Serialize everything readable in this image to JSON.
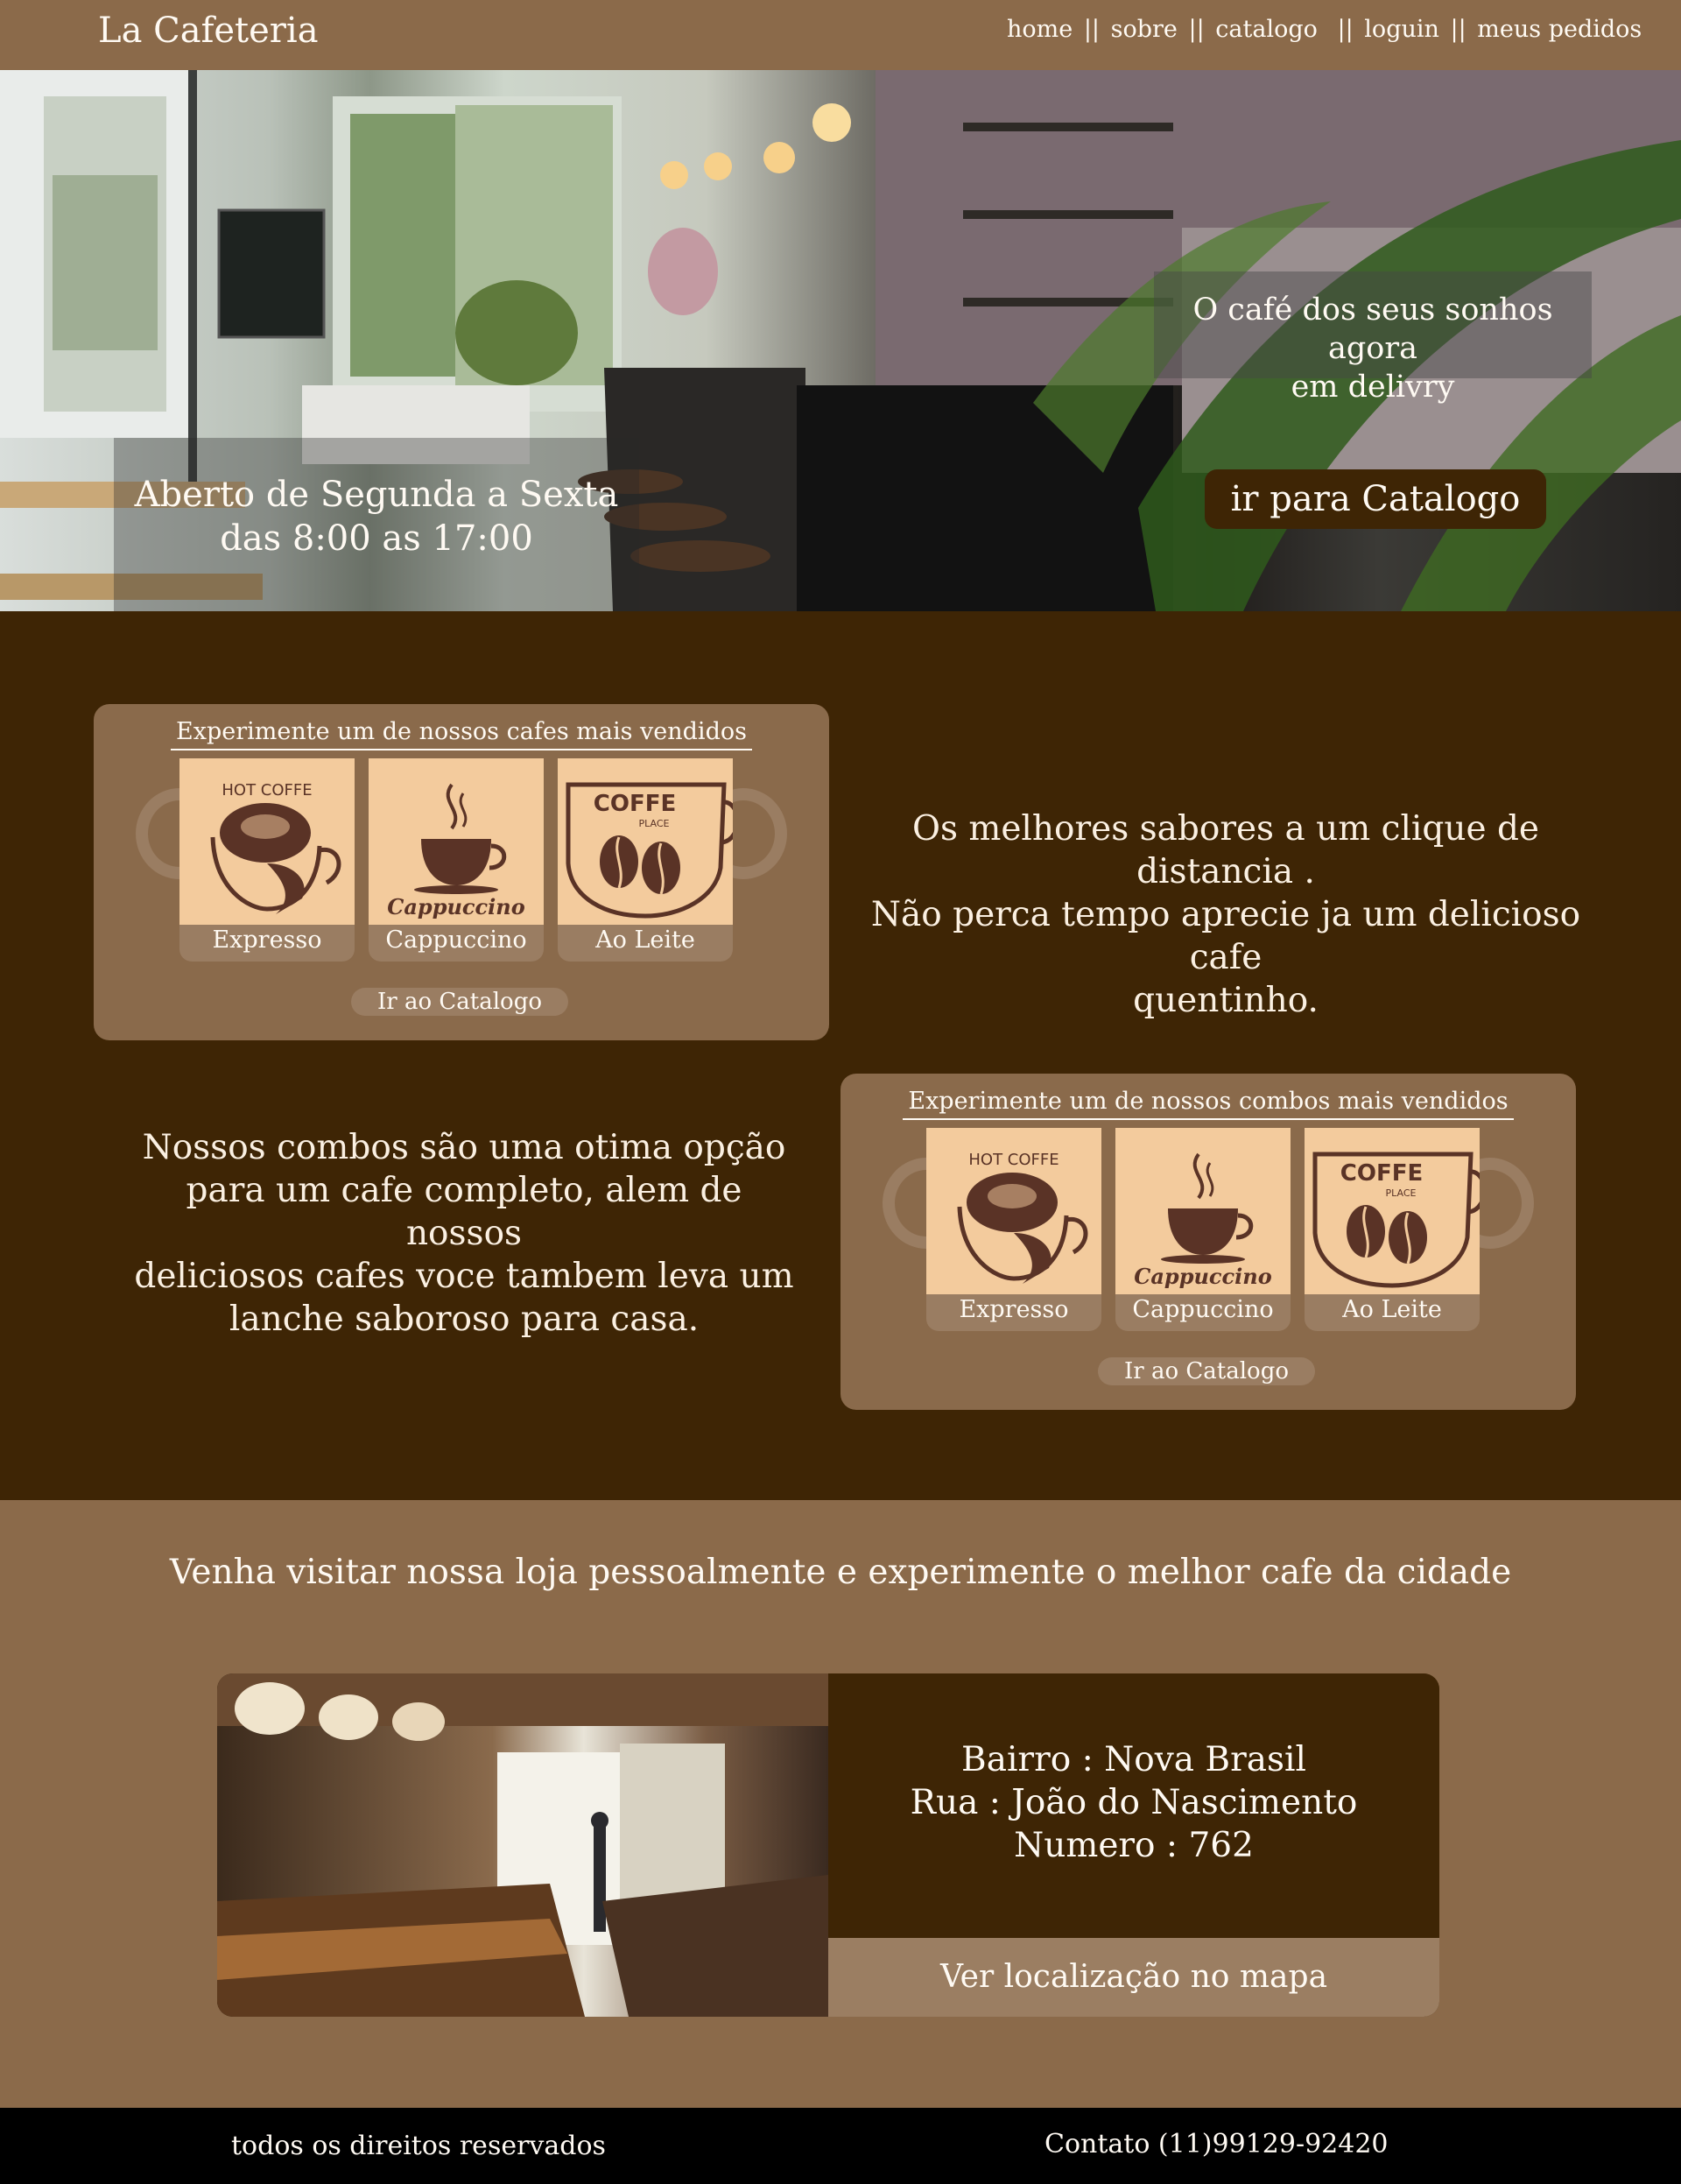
{
  "header": {
    "brand": "La Cafeteria",
    "nav": [
      {
        "label": "home"
      },
      {
        "label": "sobre"
      },
      {
        "label": "catalogo"
      },
      {
        "label": "loguin"
      },
      {
        "label": "meus pedidos"
      }
    ],
    "separator": "||"
  },
  "hero": {
    "hours_line1": "Aberto de Segunda a Sexta",
    "hours_line2": "das 8:00 as 17:00",
    "tagline_line1": "O café dos seus sonhos agora",
    "tagline_line2": "em delivry",
    "cta": "ir para Catalogo"
  },
  "cafes_card": {
    "title": "Experimente um de nossos cafes mais vendidos",
    "items": [
      {
        "label": "Expresso",
        "icon": "hot-coffee-icon"
      },
      {
        "label": "Cappuccino",
        "icon": "cappuccino-icon"
      },
      {
        "label": "Ao Leite",
        "icon": "coffee-place-icon"
      }
    ],
    "button": "Ir ao Catalogo"
  },
  "cafes_promo": {
    "line1": "Os melhores sabores a um clique de distancia .",
    "line2": "Não perca tempo aprecie ja um delicioso cafe",
    "line3": "quentinho."
  },
  "combos_card": {
    "title": "Experimente um de nossos combos mais vendidos",
    "items": [
      {
        "label": "Expresso",
        "icon": "hot-coffee-icon"
      },
      {
        "label": "Cappuccino",
        "icon": "cappuccino-icon"
      },
      {
        "label": "Ao Leite",
        "icon": "coffee-place-icon"
      }
    ],
    "button": "Ir ao Catalogo"
  },
  "combos_promo": {
    "line1": "Nossos combos são uma otima opção",
    "line2": "para um cafe completo, alem de nossos",
    "line3": "deliciosos cafes voce tambem leva um",
    "line4": "lanche saboroso para casa."
  },
  "icon_text": {
    "hot_coffee": "HOT COFFE",
    "cappuccino": "Cappuccino",
    "coffe": "COFFE",
    "place": "PLACE"
  },
  "visit": {
    "title": "Venha visitar nossa loja pessoalmente e experimente o melhor cafe da cidade",
    "bairro": "Bairro : Nova Brasil",
    "rua": "Rua : João do Nascimento",
    "numero": "Numero : 762",
    "map_button": "Ver localização no mapa"
  },
  "footer": {
    "rights": "todos os direitos reservados",
    "contact": "Contato (11)99129-92420"
  },
  "colors": {
    "dark_brown": "#3e2505",
    "mid_brown": "#8b6a4a",
    "light_brown": "#9a7d62",
    "cream": "#f3cb9d",
    "icon_brown": "#5a3326"
  }
}
